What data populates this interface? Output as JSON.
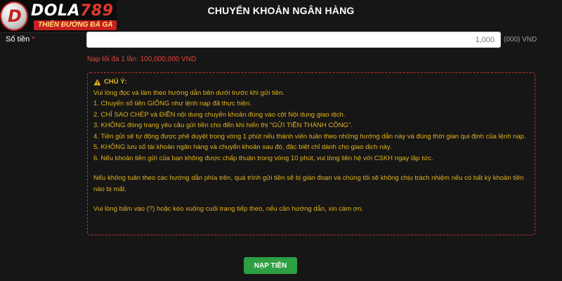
{
  "logo": {
    "brand_name": "DOLA",
    "brand_number": "789",
    "tagline": "THIÊN ĐƯỜNG ĐÁ GÀ",
    "emblem_letter": "D"
  },
  "page": {
    "title": "CHUYỂN KHOẢN NGÂN HÀNG"
  },
  "amount": {
    "label": "Số tiền",
    "required_mark": "*",
    "value": "1,000",
    "unit": "(000) VND",
    "max_note": "Nạp tối đa 1 lần: 100,000,000 VND"
  },
  "notice": {
    "heading": "CHÚ Ý:",
    "intro": "Vui lòng đọc và làm theo hướng dẫn bên dưới trước khi gửi tiền.",
    "items": [
      "1. Chuyển số tiền GIỐNG như lệnh nạp đã thực hiện.",
      "2. CHỈ SAO CHÉP và ĐIỀN nội dung chuyển khoản đúng vào cột Nội dung giao dịch.",
      "3. KHÔNG đóng trang yêu cầu gửi tiền cho đến khi hiển thị \"GỬI TIỀN THÀNH CÔNG\".",
      "4. Tiền gửi sẽ tự động được phê duyệt trong vòng 1 phút nếu thành viên tuân theo những hướng dẫn này và đúng thời gian qui định của lệnh nạp.",
      "5. KHÔNG lưu số tài khoản ngân hàng và chuyển khoản sau đó, đặc biệt chỉ dành cho giao dịch này.",
      "6. Nếu khoản tiền gửi của bạn không được chấp thuận trong vòng 10 phút, vui lòng liên hệ với CSKH ngay lập tức."
    ],
    "disclaimer": "Nếu không tuân theo các hướng dẫn phía trên, quá trình gửi tiền sẽ bị gián đoạn và chúng tôi sẽ không chịu trách nhiệm nếu có bất kỳ khoản tiền nào bị mất.",
    "help": "Vui lòng bấm vào (?) hoặc kéo xuống cuối trang tiếp theo, nếu cần hướng dẫn, xin cảm ơn."
  },
  "submit": {
    "label": "NẠP TIỀN"
  },
  "colors": {
    "background": "#161616",
    "accent_red": "#c43232",
    "notice_text": "#e2b21e",
    "submit_green": "#2e9f43"
  },
  "icons": {
    "logo_emblem": "dola-emblem-icon",
    "warning": "warning-triangle-icon"
  }
}
